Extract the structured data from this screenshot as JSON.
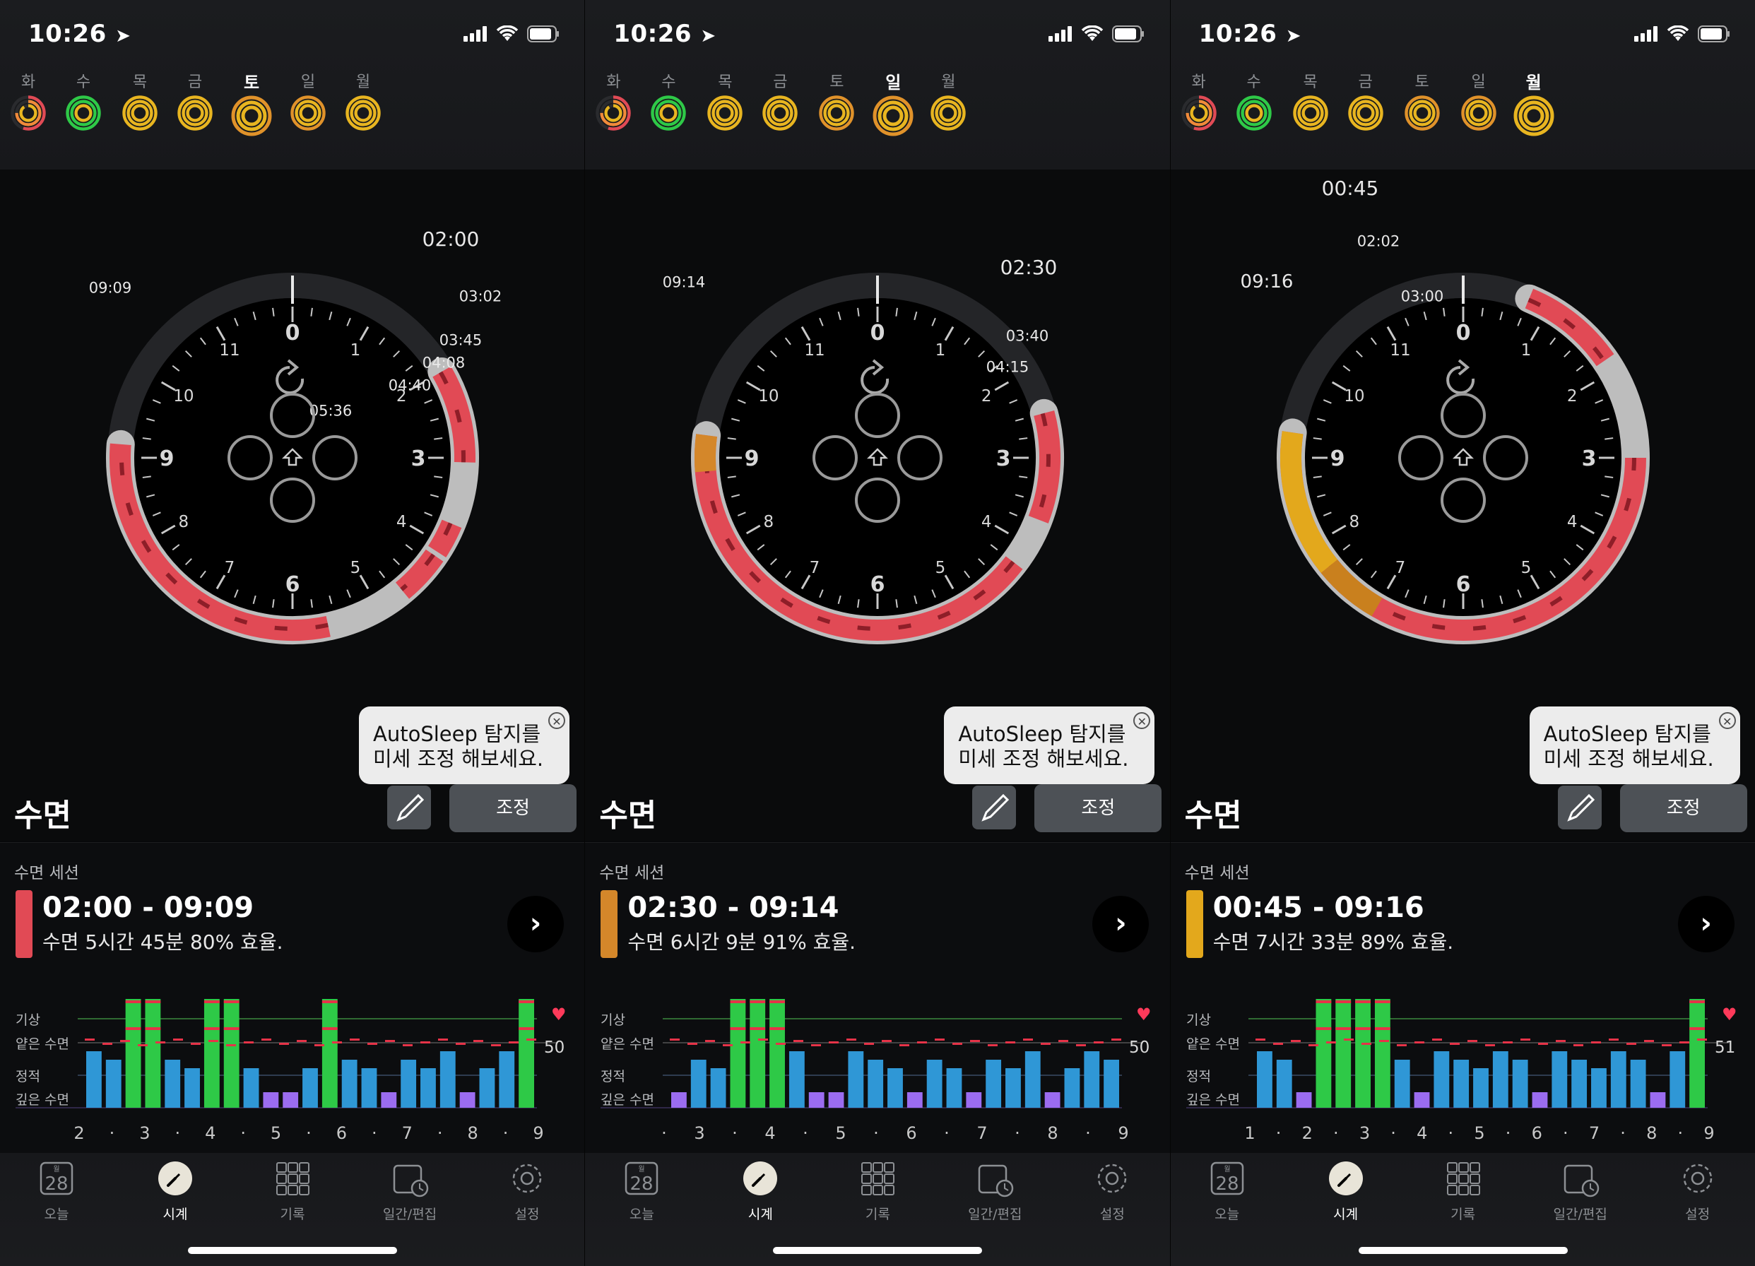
{
  "status": {
    "time": "10:26"
  },
  "days": [
    "화",
    "수",
    "목",
    "금",
    "토",
    "일",
    "월"
  ],
  "rings": [
    {
      "outer": "#e14a55",
      "middle": "#f08a3a",
      "inner": "#e8b520",
      "fill": [
        0.55,
        0.75,
        0.9
      ]
    },
    {
      "outer": "#2ec947",
      "middle": "#2ec947",
      "inner": "#e8b520",
      "fill": [
        1,
        1,
        1
      ]
    },
    {
      "outer": "#e8b520",
      "middle": "#e8b520",
      "inner": "#e8b520",
      "fill": [
        1,
        1,
        1
      ]
    },
    {
      "outer": "#e8b520",
      "middle": "#e8b520",
      "inner": "#e8b520",
      "fill": [
        1,
        1,
        1
      ]
    },
    {
      "outer": "#e0922a",
      "middle": "#e8b520",
      "inner": "#e8b520",
      "fill": [
        1,
        1,
        1
      ]
    },
    {
      "outer": "#e0922a",
      "middle": "#e8b520",
      "inner": "#e8b520",
      "fill": [
        1,
        1,
        1
      ]
    },
    {
      "outer": "#e8b520",
      "middle": "#e8b520",
      "inner": "#e8b520",
      "fill": [
        1,
        1,
        1
      ]
    }
  ],
  "clock": {
    "hours": [
      "0",
      "1",
      "2",
      "3",
      "4",
      "5",
      "6",
      "7",
      "8",
      "9",
      "10",
      "11"
    ]
  },
  "tip": {
    "line1": "AutoSleep 탐지를",
    "line2": "미세 조정 해보세요."
  },
  "labels": {
    "sleep_title": "수면",
    "adjust": "조정",
    "session_label": "수면 세션",
    "chevron": "›"
  },
  "chart_labels": {
    "awake": "기상",
    "light": "얕은 수면",
    "quiet": "정적",
    "deep": "깊은 수면"
  },
  "tabs": [
    {
      "label": "오늘",
      "icon": "calendar-icon",
      "cal_month": "월",
      "cal_day": "28"
    },
    {
      "label": "시계",
      "icon": "clock-icon"
    },
    {
      "label": "기록",
      "icon": "grid-icon"
    },
    {
      "label": "일간/편집",
      "icon": "calendar-edit-icon"
    },
    {
      "label": "설정",
      "icon": "gear-icon"
    }
  ],
  "panels": [
    {
      "selected_day": 4,
      "session": {
        "range": "02:00 - 09:09",
        "summary": "수면 5시간 45분 80% 효율.",
        "color": "#e14a55"
      },
      "arc_primary": "#e14a55",
      "times": [
        "02:00",
        "03:02",
        "03:45",
        "04:08",
        "04:40",
        "05:36",
        "09:09"
      ],
      "heart_rate": "50",
      "xticks": [
        "2",
        "·",
        "3",
        "·",
        "4",
        "·",
        "5",
        "·",
        "6",
        "·",
        "7",
        "·",
        "8",
        "·",
        "9"
      ]
    },
    {
      "selected_day": 5,
      "session": {
        "range": "02:30 - 09:14",
        "summary": "수면 6시간 9분 91% 효율.",
        "color": "#d4872a"
      },
      "arc_primary": "#e14a55",
      "times": [
        "02:30",
        "03:40",
        "04:15",
        "09:14"
      ],
      "heart_rate": "50",
      "xticks": [
        "·",
        "3",
        "·",
        "4",
        "·",
        "5",
        "·",
        "6",
        "·",
        "7",
        "·",
        "8",
        "·",
        "9"
      ]
    },
    {
      "selected_day": 6,
      "session": {
        "range": "00:45 - 09:16",
        "summary": "수면 7시간 33분 89% 효율.",
        "color": "#e3a81c"
      },
      "arc_primary": "#e14a55",
      "times": [
        "00:45",
        "02:02",
        "03:00",
        "09:16"
      ],
      "heart_rate": "51",
      "xticks": [
        "1",
        "·",
        "2",
        "·",
        "3",
        "·",
        "4",
        "·",
        "5",
        "·",
        "6",
        "·",
        "7",
        "·",
        "8",
        "·",
        "9"
      ]
    }
  ]
}
